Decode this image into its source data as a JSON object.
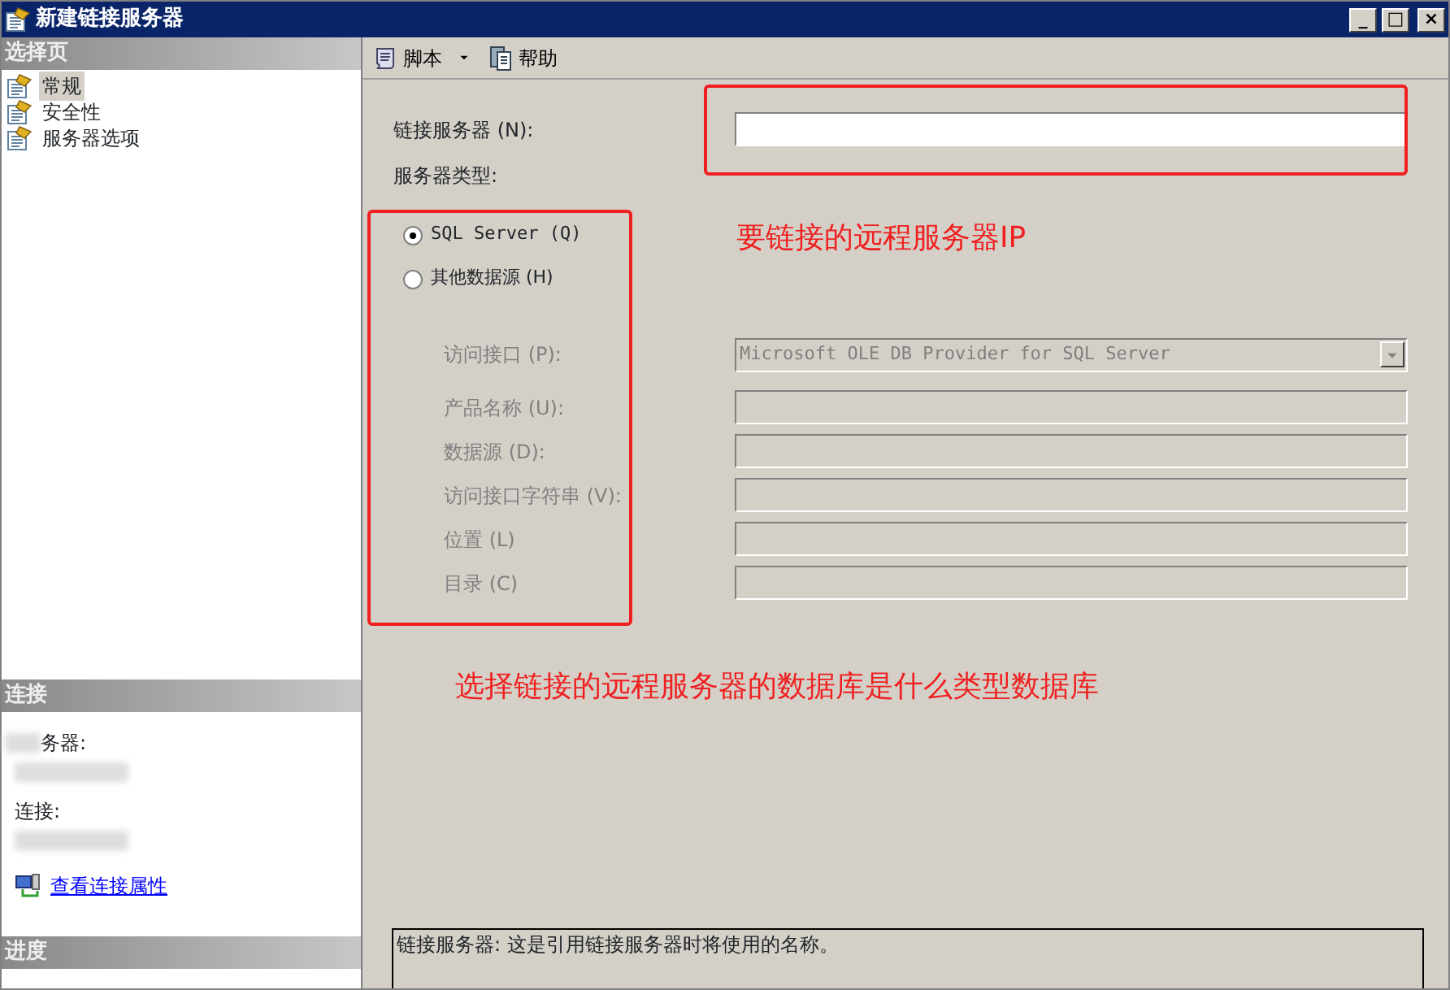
{
  "window": {
    "title": "新建链接服务器",
    "controls": [
      "_",
      "□",
      "×"
    ]
  },
  "sidebar": {
    "select_page_header": "选择页",
    "pages": [
      {
        "label": "常规",
        "selected": true
      },
      {
        "label": "安全性",
        "selected": false
      },
      {
        "label": "服务器选项",
        "selected": false
      }
    ],
    "connection_header": "连接",
    "connection_fields": [
      "务器:",
      "连接:"
    ],
    "connection_link": "查看连接属性",
    "progress_header": "进度"
  },
  "toolbar": [
    {
      "label": "脚本",
      "dropdown": true
    },
    {
      "label": "帮助",
      "dropdown": false
    }
  ],
  "form": {
    "linked_server_label": "链接服务器 (N):",
    "server_type_label": "服务器类型:",
    "server_types": [
      {
        "label": "SQL Server (Q)",
        "selected": true
      },
      {
        "label": "其他数据源 (H)",
        "selected": false
      }
    ],
    "provider_fields": [
      {
        "label": "访问接口 (P):",
        "kind": "select",
        "value": "Microsoft OLE DB Provider for SQL Server",
        "disabled": true
      },
      {
        "label": "产品名称 (U):",
        "kind": "text",
        "disabled": true
      },
      {
        "label": "数据源 (D):",
        "kind": "text",
        "disabled": true
      },
      {
        "label": "访问接口字符串 (V):",
        "kind": "text",
        "disabled": true
      },
      {
        "label": "位置 (L)",
        "kind": "text",
        "disabled": true
      },
      {
        "label": "目录 (C)",
        "kind": "text",
        "disabled": true
      }
    ],
    "description": "链接服务器: 这是引用链接服务器时将使用的名称。"
  },
  "annotations": [
    {
      "text": "要链接的远程服务器IP"
    },
    {
      "text": "选择链接的远程服务器的数据库是什么类型数据库"
    }
  ]
}
